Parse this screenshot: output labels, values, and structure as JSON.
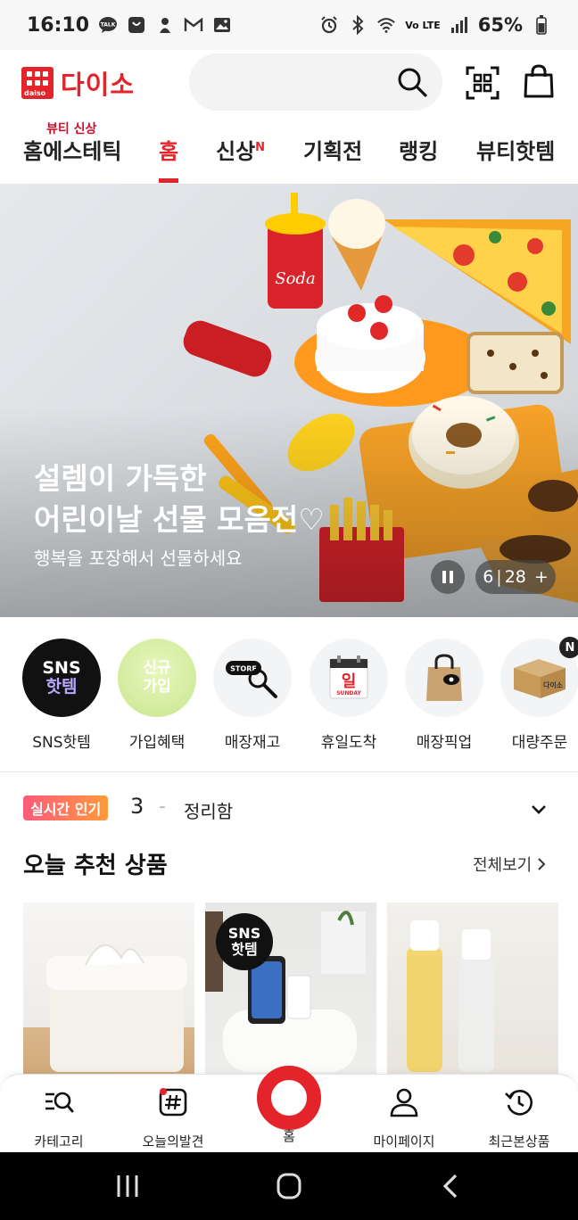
{
  "status_bar": {
    "time": "16:10",
    "battery": "65%",
    "network": "Vo LTE"
  },
  "header": {
    "logo_text": "다이소",
    "logo_small": "daiso",
    "search_placeholder": ""
  },
  "tabs": [
    {
      "label": "홈에스테틱",
      "super": "뷰티 신상"
    },
    {
      "label": "홈",
      "active": true
    },
    {
      "label": "신상",
      "badge": "N"
    },
    {
      "label": "기획전"
    },
    {
      "label": "랭킹"
    },
    {
      "label": "뷰티핫템"
    }
  ],
  "banner": {
    "title_line1": "설렘이 가득한",
    "title_line2": "어린이날 선물 모음전♡",
    "subtitle": "행복을 포장해서 선물하세요",
    "page_current": "6",
    "separator": "|",
    "page_total": "28",
    "more": "+"
  },
  "quick_menu": [
    {
      "label": "SNS핫템",
      "icon_text1": "SNS",
      "icon_text2": "핫템"
    },
    {
      "label": "가입혜택",
      "icon_text1": "신규",
      "icon_text2": "가입"
    },
    {
      "label": "매장재고",
      "icon_text": "STORE"
    },
    {
      "label": "휴일도착",
      "icon_text": "일",
      "icon_sub": "SUNDAY"
    },
    {
      "label": "매장픽업"
    },
    {
      "label": "대량주문",
      "icon_text": "다이소",
      "badge": "N"
    }
  ],
  "realtime": {
    "badge": "실시간 인기",
    "rank": "3",
    "dash": "-",
    "keyword": "정리함"
  },
  "recommend": {
    "title": "오늘 추천 상품",
    "view_all": "전체보기",
    "sns_badge_line1": "SNS",
    "sns_badge_line2": "핫템"
  },
  "bottom_nav": [
    {
      "label": "카테고리",
      "icon": "category-search-icon"
    },
    {
      "label": "오늘의발견",
      "icon": "hashtag-icon"
    },
    {
      "label": "홈",
      "icon": "home-ring-icon"
    },
    {
      "label": "마이페이지",
      "icon": "person-icon"
    },
    {
      "label": "최근본상품",
      "icon": "history-icon"
    }
  ],
  "colors": {
    "brand_red": "#e3242b",
    "text": "#222222"
  }
}
